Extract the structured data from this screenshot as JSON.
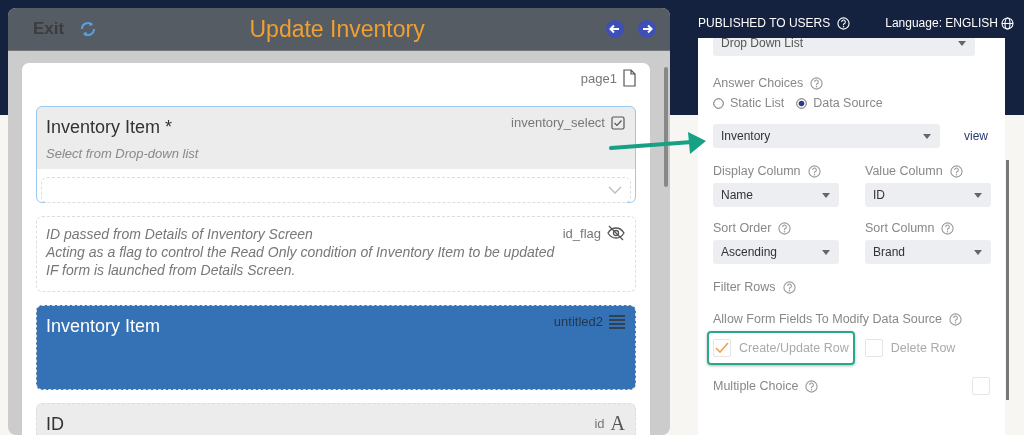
{
  "app_header": {
    "exit": "Exit",
    "title": "Update Inventory"
  },
  "page": {
    "label": "page1"
  },
  "fields": [
    {
      "kind": "dropdown",
      "selected": true,
      "title": "Inventory Item *",
      "hint": "Select from Drop-down list",
      "key": "inventory_select"
    },
    {
      "kind": "note",
      "selected": false,
      "lines": [
        "ID passed from Details of Inventory Screen",
        "Acting as a flag to control the Read Only condition of Inventory Item to be updated",
        "IF form is launched from Details Screen."
      ],
      "key": "id_flag"
    },
    {
      "kind": "section",
      "selected": false,
      "title": "Inventory Item",
      "key": "untitled2"
    },
    {
      "kind": "text",
      "selected": false,
      "title": "ID",
      "key": "id",
      "type_icon": "A"
    }
  ],
  "top_bar": {
    "published": "PUBLISHED TO USERS",
    "language": "Language: ENGLISH"
  },
  "settings": {
    "question_type": "Drop Down List",
    "answer_choices": {
      "label": "Answer Choices",
      "options": [
        {
          "label": "Static List",
          "selected": false
        },
        {
          "label": "Data Source",
          "selected": true
        }
      ]
    },
    "data_source": {
      "value": "Inventory",
      "link": "view"
    },
    "columns": [
      {
        "label": "Display Column",
        "value": "Name"
      },
      {
        "label": "Value Column",
        "value": "ID"
      },
      {
        "label": "Sort Order",
        "value": "Ascending"
      },
      {
        "label": "Sort Column",
        "value": "Brand"
      }
    ],
    "filter_rows": "Filter Rows",
    "modify": {
      "label": "Allow Form Fields To Modify Data Source",
      "options": [
        {
          "label": "Create/Update Row",
          "checked": true,
          "highlighted": true
        },
        {
          "label": "Delete Row",
          "checked": false,
          "highlighted": false
        }
      ]
    },
    "multiple_choice": {
      "label": "Multiple Choice",
      "checked": false
    }
  }
}
